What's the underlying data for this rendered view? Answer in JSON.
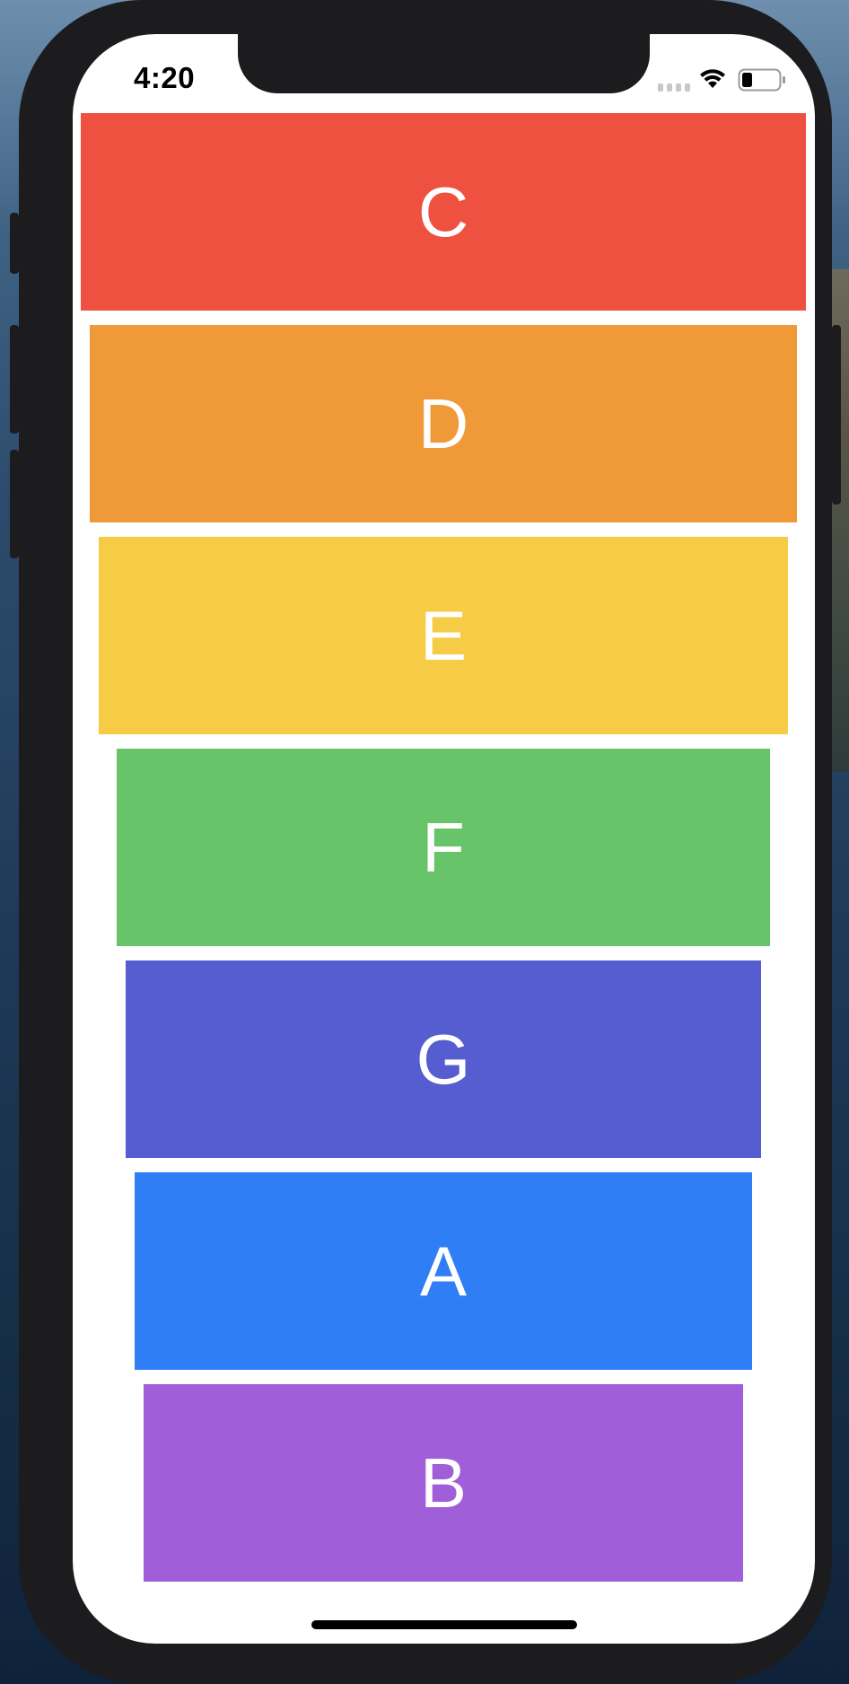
{
  "status_bar": {
    "time": "4:20",
    "icons": [
      "cellular-signal-icon",
      "wifi-icon",
      "battery-icon"
    ]
  },
  "list": {
    "items": [
      {
        "label": "C",
        "color": "#ef5141"
      },
      {
        "label": "D",
        "color": "#f09939"
      },
      {
        "label": "E",
        "color": "#f6cb46"
      },
      {
        "label": "F",
        "color": "#68c468"
      },
      {
        "label": "G",
        "color": "#555dd0"
      },
      {
        "label": "A",
        "color": "#2f7ef5"
      },
      {
        "label": "B",
        "color": "#a05ed8"
      }
    ]
  }
}
